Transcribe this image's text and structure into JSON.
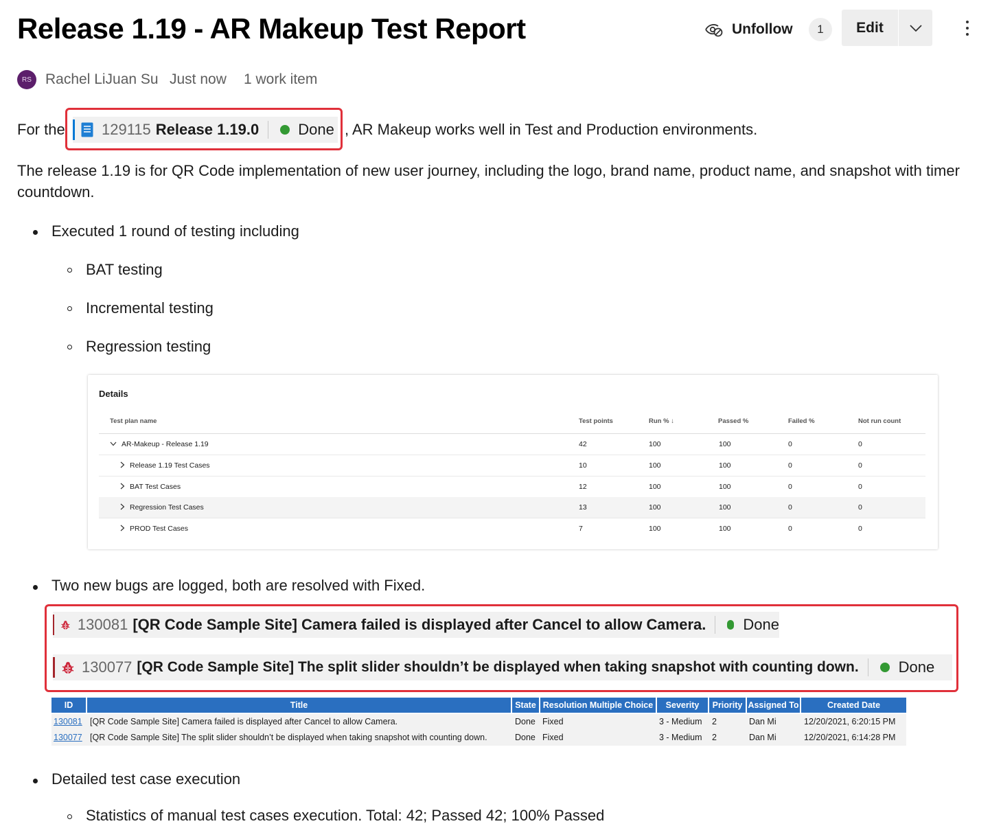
{
  "header": {
    "title": "Release 1.19 - AR Makeup Test Report",
    "unfollow_label": "Unfollow",
    "follow_count": "1",
    "edit_label": "Edit"
  },
  "meta": {
    "avatar_initials": "RS",
    "author": "Rachel LiJuan Su",
    "time": "Just now",
    "work_items": "1 work item"
  },
  "body": {
    "intro_prefix": "For the",
    "intro_suffix": ", AR Makeup works well in Test and Production environments.",
    "release_item": {
      "id": "129115",
      "title": "Release 1.19.0",
      "state": "Done"
    },
    "paragraph2": "The release 1.19 is for QR Code implementation of new user journey, including the logo, brand name, product name, and snapshot with timer countdown.",
    "bullet1": "Executed 1 round of testing including",
    "sub_bullets": [
      "BAT testing",
      "Incremental testing",
      "Regression testing"
    ],
    "bullet2": "Two new bugs are logged, both are resolved with Fixed.",
    "bullet3": "Detailed test case execution",
    "bullet3_sub": "Statistics of manual test cases execution. Total: 42; Passed 42; 100% Passed"
  },
  "details": {
    "title": "Details",
    "headers": [
      "Test plan name",
      "Test points",
      "Run % ↓",
      "Passed %",
      "Failed %",
      "Not run count"
    ],
    "rows": [
      [
        "AR-Makeup - Release 1.19",
        "42",
        "100",
        "100",
        "0",
        "0"
      ],
      [
        "Release 1.19 Test Cases",
        "10",
        "100",
        "100",
        "0",
        "0"
      ],
      [
        "BAT Test Cases",
        "12",
        "100",
        "100",
        "0",
        "0"
      ],
      [
        "Regression Test Cases",
        "13",
        "100",
        "100",
        "0",
        "0"
      ],
      [
        "PROD Test Cases",
        "7",
        "100",
        "100",
        "0",
        "0"
      ]
    ]
  },
  "bugs": [
    {
      "id": "130081",
      "title": "[QR Code Sample Site] Camera failed is displayed after Cancel to allow Camera.",
      "state": "Done"
    },
    {
      "id": "130077",
      "title": "[QR Code Sample Site] The split slider shouldn’t be displayed when taking snapshot with counting down.",
      "state": "Done"
    }
  ],
  "bug_table": {
    "headers": [
      "ID",
      "Title",
      "State",
      "Resolution Multiple Choice",
      "Severity",
      "Priority",
      "Assigned To",
      "Created Date"
    ],
    "rows": [
      [
        "130081",
        "[QR Code Sample Site] Camera failed is displayed after Cancel to allow Camera.",
        "Done",
        "Fixed",
        "3 - Medium",
        "2",
        "Dan Mi",
        "12/20/2021, 6:20:15 PM"
      ],
      [
        "130077",
        "[QR Code Sample Site] The split slider shouldn’t be displayed when taking snapshot with counting down.",
        "Done",
        "Fixed",
        "3 - Medium",
        "2",
        "Dan Mi",
        "12/20/2021, 6:14:28 PM"
      ]
    ]
  },
  "colors": {
    "done_green": "#339933",
    "highlight_red": "#e0303a",
    "table_header_blue": "#2a6fc0",
    "avatar_purple": "#5c1f6b"
  }
}
